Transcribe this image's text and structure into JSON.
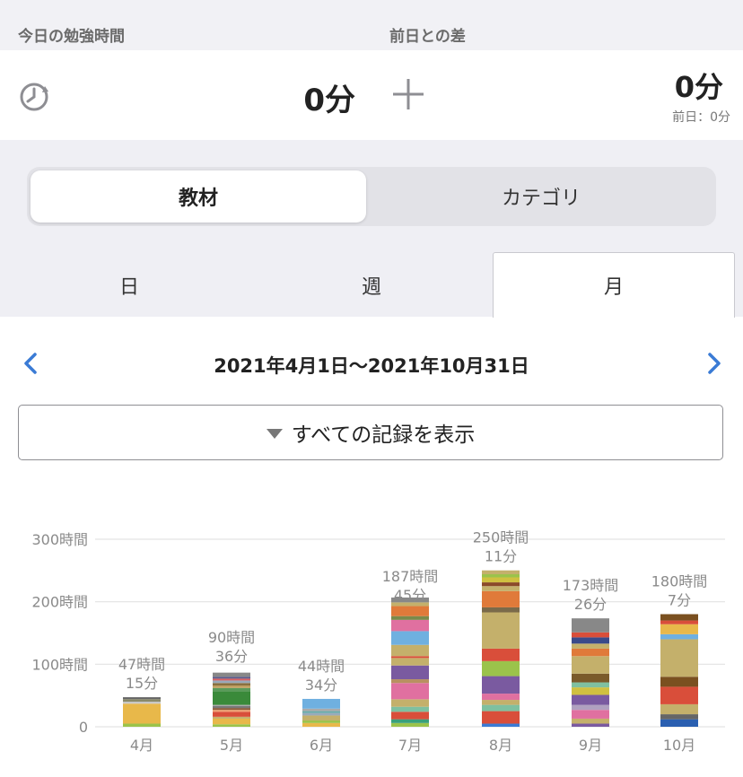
{
  "header": {
    "today_label": "今日の勉強時間",
    "diff_label": "前日との差"
  },
  "stats": {
    "today_value": "0分",
    "diff_value": "0分",
    "prev_day": "前日：0分"
  },
  "segment": {
    "active": "教材",
    "inactive": "カテゴリ"
  },
  "tabs": [
    {
      "label": "日"
    },
    {
      "label": "週"
    },
    {
      "label": "月"
    }
  ],
  "range": {
    "label": "2021年4月1日〜2021年10月31日"
  },
  "filter": {
    "label": "すべての記録を表示"
  },
  "colors": {
    "accent": "#3a7bd5",
    "text": "#222222",
    "muted": "#8a8a8a"
  },
  "chart_data": {
    "type": "bar",
    "stacked": true,
    "categories": [
      "4月",
      "5月",
      "6月",
      "7月",
      "8月",
      "9月",
      "10月"
    ],
    "values": [
      47.25,
      90.6,
      44.57,
      187.75,
      250.18,
      173.43,
      180.12
    ],
    "value_labels": [
      [
        "47時間",
        "15分"
      ],
      [
        "90時間",
        "36分"
      ],
      [
        "44時間",
        "34分"
      ],
      [
        "187時間",
        "45分"
      ],
      [
        "250時間",
        "11分"
      ],
      [
        "173時間",
        "26分"
      ],
      [
        "180時間",
        "7分"
      ]
    ],
    "yticks": [
      0,
      100,
      200,
      300
    ],
    "ytick_labels": [
      "0",
      "100時間",
      "200時間",
      "300時間"
    ],
    "ylim": [
      0,
      300
    ],
    "grid": true,
    "stacks": [
      [
        {
          "c": "#9bc34b",
          "v": 5
        },
        {
          "c": "#e8b84a",
          "v": 32
        },
        {
          "c": "#c9c9c9",
          "v": 3
        },
        {
          "c": "#8a8a6a",
          "v": 4.25
        },
        {
          "c": "#666",
          "v": 3
        }
      ],
      [
        {
          "c": "#9bc34b",
          "v": 4
        },
        {
          "c": "#e8b84a",
          "v": 9
        },
        {
          "c": "#c4b06b",
          "v": 3
        },
        {
          "c": "#d94e3a",
          "v": 8
        },
        {
          "c": "#f0a070",
          "v": 3
        },
        {
          "c": "#8b5a3a",
          "v": 3
        },
        {
          "c": "#777",
          "v": 3
        },
        {
          "c": "#aaa",
          "v": 2
        },
        {
          "c": "#3a8a3a",
          "v": 22
        },
        {
          "c": "#5a9a5a",
          "v": 5
        },
        {
          "c": "#c0a060",
          "v": 4
        },
        {
          "c": "#8a7040",
          "v": 4
        },
        {
          "c": "#9ab",
          "v": 4
        },
        {
          "c": "#d96060",
          "v": 3
        },
        {
          "c": "#5a5a8a",
          "v": 3
        },
        {
          "c": "#888",
          "v": 6.6
        }
      ],
      [
        {
          "c": "#e8b84a",
          "v": 6
        },
        {
          "c": "#9bc34b",
          "v": 4
        },
        {
          "c": "#c4b06b",
          "v": 8
        },
        {
          "c": "#9ab",
          "v": 4
        },
        {
          "c": "#6aa",
          "v": 3
        },
        {
          "c": "#aaa",
          "v": 4
        },
        {
          "c": "#6fb0e0",
          "v": 15.57
        }
      ],
      [
        {
          "c": "#9bc34b",
          "v": 6
        },
        {
          "c": "#3aa07a",
          "v": 6
        },
        {
          "c": "#d94e3a",
          "v": 12
        },
        {
          "c": "#7fc0a0",
          "v": 8
        },
        {
          "c": "#c4b06b",
          "v": 12
        },
        {
          "c": "#e070a0",
          "v": 26
        },
        {
          "c": "#b89060",
          "v": 6
        },
        {
          "c": "#7a5aa0",
          "v": 22
        },
        {
          "c": "#c4b06b",
          "v": 12
        },
        {
          "c": "#d94e3a",
          "v": 3
        },
        {
          "c": "#c4b06b",
          "v": 18
        },
        {
          "c": "#6fb0e0",
          "v": 22
        },
        {
          "c": "#e070a0",
          "v": 18
        },
        {
          "c": "#7a8a4a",
          "v": 6
        },
        {
          "c": "#e07a3a",
          "v": 16
        },
        {
          "c": "#c4b06b",
          "v": 6
        },
        {
          "c": "#888",
          "v": 7.75
        }
      ],
      [
        {
          "c": "#3a7bd5",
          "v": 5
        },
        {
          "c": "#d94e3a",
          "v": 20
        },
        {
          "c": "#7fc0a0",
          "v": 10
        },
        {
          "c": "#c4b06b",
          "v": 8
        },
        {
          "c": "#e070a0",
          "v": 10
        },
        {
          "c": "#7a5aa0",
          "v": 28
        },
        {
          "c": "#9bc34b",
          "v": 24
        },
        {
          "c": "#d94e3a",
          "v": 20
        },
        {
          "c": "#c4b06b",
          "v": 58
        },
        {
          "c": "#7a6a4a",
          "v": 8
        },
        {
          "c": "#e07a3a",
          "v": 26
        },
        {
          "c": "#c4b06b",
          "v": 8
        },
        {
          "c": "#8b4a2a",
          "v": 6
        },
        {
          "c": "#d0c040",
          "v": 8
        },
        {
          "c": "#9bc34b",
          "v": 5
        },
        {
          "c": "#c4b06b",
          "v": 6.18
        }
      ],
      [
        {
          "c": "#7a5aa0",
          "v": 5
        },
        {
          "c": "#c4b06b",
          "v": 8
        },
        {
          "c": "#e070a0",
          "v": 14
        },
        {
          "c": "#b0a0c0",
          "v": 8
        },
        {
          "c": "#7a5aa0",
          "v": 16
        },
        {
          "c": "#d0c040",
          "v": 12
        },
        {
          "c": "#7fc0a0",
          "v": 8
        },
        {
          "c": "#7a5a2a",
          "v": 14
        },
        {
          "c": "#c4b06b",
          "v": 28
        },
        {
          "c": "#e07a3a",
          "v": 12
        },
        {
          "c": "#c4b06b",
          "v": 8
        },
        {
          "c": "#3a4a8a",
          "v": 10
        },
        {
          "c": "#d94e3a",
          "v": 8
        },
        {
          "c": "#888",
          "v": 22.43
        }
      ],
      [
        {
          "c": "#2a5fb0",
          "v": 12
        },
        {
          "c": "#666",
          "v": 8
        },
        {
          "c": "#c4b06b",
          "v": 16
        },
        {
          "c": "#d94e3a",
          "v": 28
        },
        {
          "c": "#7a5020",
          "v": 16
        },
        {
          "c": "#c4b06b",
          "v": 60
        },
        {
          "c": "#6fb0e0",
          "v": 8
        },
        {
          "c": "#e8b84a",
          "v": 16
        },
        {
          "c": "#d94e3a",
          "v": 6
        },
        {
          "c": "#7a5020",
          "v": 10.12
        }
      ]
    ]
  }
}
